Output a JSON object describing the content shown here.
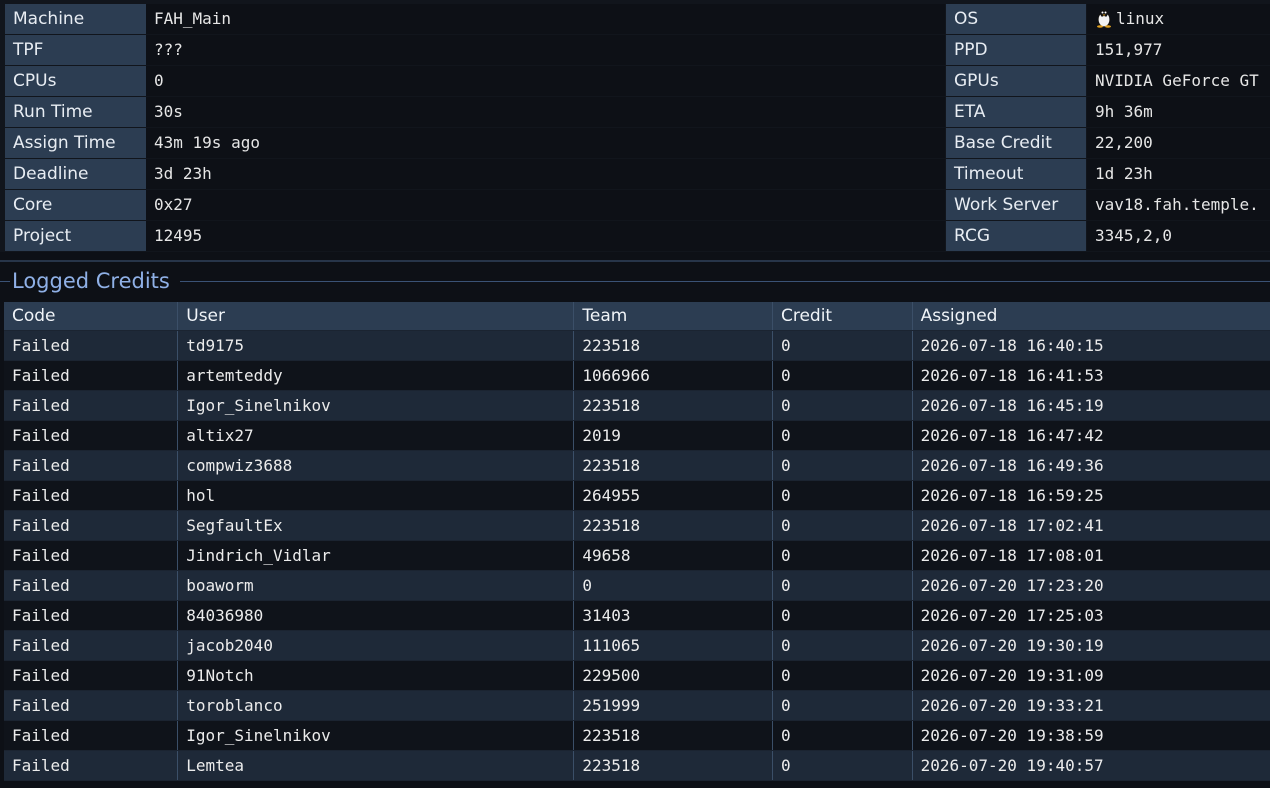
{
  "info": {
    "rows": [
      {
        "label": "Machine",
        "value": "FAH_Main",
        "label2": "OS",
        "value2": "linux",
        "icon2": "linux-tux-icon"
      },
      {
        "label": "TPF",
        "value": "???",
        "label2": "PPD",
        "value2": "151,977"
      },
      {
        "label": "CPUs",
        "value": "0",
        "label2": "GPUs",
        "value2": "NVIDIA GeForce GT"
      },
      {
        "label": "Run Time",
        "value": "30s",
        "label2": "ETA",
        "value2": "9h 36m"
      },
      {
        "label": "Assign Time",
        "value": "43m 19s ago",
        "label2": "Base Credit",
        "value2": "22,200"
      },
      {
        "label": "Deadline",
        "value": "3d 23h",
        "label2": "Timeout",
        "value2": "1d 23h"
      },
      {
        "label": "Core",
        "value": "0x27",
        "label2": "Work Server",
        "value2": "vav18.fah.temple."
      },
      {
        "label": "Project",
        "value": "12495",
        "label2": "RCG",
        "value2": "3345,2,0"
      }
    ]
  },
  "logged_credits": {
    "title": "Logged Credits",
    "columns": [
      "Code",
      "User",
      "Team",
      "Credit",
      "Assigned"
    ],
    "rows": [
      [
        "Failed",
        "td9175",
        "223518",
        "0",
        "2026-07-18 16:40:15"
      ],
      [
        "Failed",
        "artemteddy",
        "1066966",
        "0",
        "2026-07-18 16:41:53"
      ],
      [
        "Failed",
        "Igor_Sinelnikov",
        "223518",
        "0",
        "2026-07-18 16:45:19"
      ],
      [
        "Failed",
        "altix27",
        "2019",
        "0",
        "2026-07-18 16:47:42"
      ],
      [
        "Failed",
        "compwiz3688",
        "223518",
        "0",
        "2026-07-18 16:49:36"
      ],
      [
        "Failed",
        "hol",
        "264955",
        "0",
        "2026-07-18 16:59:25"
      ],
      [
        "Failed",
        "SegfaultEx",
        "223518",
        "0",
        "2026-07-18 17:02:41"
      ],
      [
        "Failed",
        "Jindrich_Vidlar",
        "49658",
        "0",
        "2026-07-18 17:08:01"
      ],
      [
        "Failed",
        "boaworm",
        "0",
        "0",
        "2026-07-20 17:23:20"
      ],
      [
        "Failed",
        "84036980",
        "31403",
        "0",
        "2026-07-20 17:25:03"
      ],
      [
        "Failed",
        "jacob2040",
        "111065",
        "0",
        "2026-07-20 19:30:19"
      ],
      [
        "Failed",
        "91Notch",
        "229500",
        "0",
        "2026-07-20 19:31:09"
      ],
      [
        "Failed",
        "toroblanco",
        "251999",
        "0",
        "2026-07-20 19:33:21"
      ],
      [
        "Failed",
        "Igor_Sinelnikov",
        "223518",
        "0",
        "2026-07-20 19:38:59"
      ],
      [
        "Failed",
        "Lemtea",
        "223518",
        "0",
        "2026-07-20 19:40:57"
      ]
    ]
  },
  "colors": {
    "label_bg": "#2c3d52",
    "page_bg": "#0d1016",
    "row_odd": "#1e2938",
    "row_even": "#0f131a",
    "section_title": "#8fb0e6"
  }
}
